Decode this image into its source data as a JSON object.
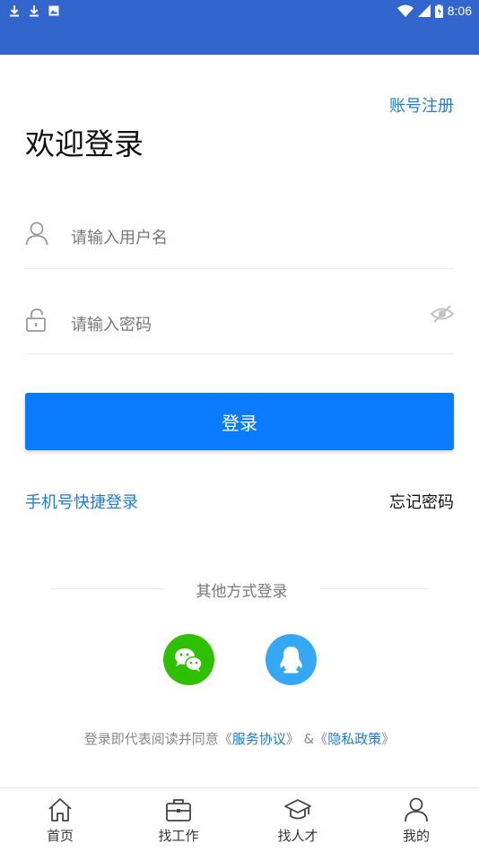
{
  "status_bar": {
    "time": "8:06",
    "left_icons": [
      "download-icon",
      "download-icon",
      "image-icon"
    ],
    "right_icons": [
      "wifi-icon",
      "signal-icon",
      "battery-icon"
    ],
    "color": "#3366cc"
  },
  "header": {
    "register_label": "账号注册",
    "title": "欢迎登录"
  },
  "form": {
    "username": {
      "placeholder": "请输入用户名",
      "value": "",
      "icon": "user-icon"
    },
    "password": {
      "placeholder": "请输入密码",
      "value": "",
      "icon": "lock-icon",
      "toggle_icon": "eye-hidden-icon"
    },
    "login_label": "登录",
    "phone_login_label": "手机号快捷登录",
    "forgot_label": "忘记密码"
  },
  "other_login": {
    "label": "其他方式登录",
    "providers": [
      {
        "name": "wechat",
        "icon": "wechat-icon",
        "color": "#2dc100"
      },
      {
        "name": "qq",
        "icon": "qq-icon",
        "color": "#35a8f5"
      }
    ]
  },
  "agreement": {
    "prefix": "登录即代表阅读并同意",
    "open_quote": "《",
    "close_quote": "》",
    "service_label": "服务协议",
    "separator": "&",
    "privacy_label": "隐私政策"
  },
  "tabs": [
    {
      "label": "首页",
      "icon": "home-icon"
    },
    {
      "label": "找工作",
      "icon": "briefcase-icon"
    },
    {
      "label": "找人才",
      "icon": "graduation-cap-icon"
    },
    {
      "label": "我的",
      "icon": "person-icon"
    }
  ],
  "colors": {
    "accent": "#0a7bff",
    "link": "#1a7ce6"
  }
}
